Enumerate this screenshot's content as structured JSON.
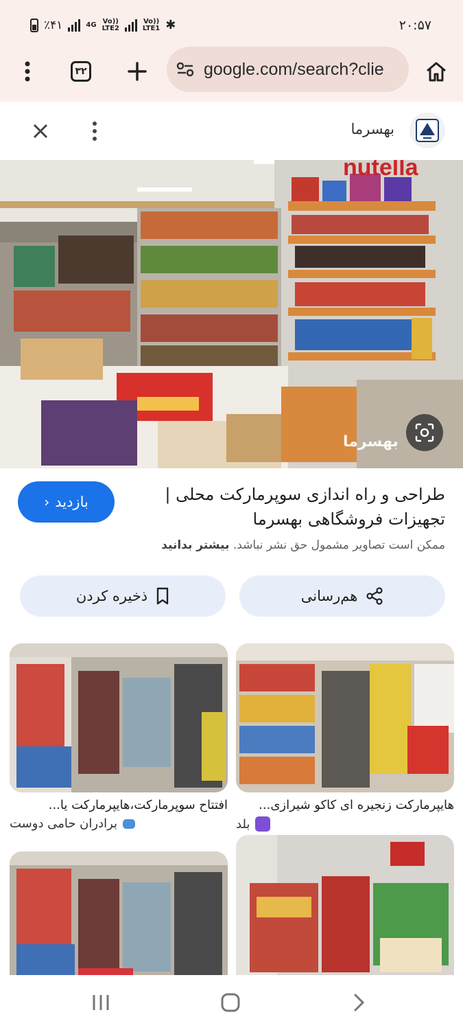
{
  "status_bar": {
    "time": "۲۰:۵۷",
    "battery": "٪۴۱",
    "net1": "4G",
    "net2": "Vo))\nLTE2",
    "net3": "Vo))\nLTE1"
  },
  "browser": {
    "tab_count": "۳۲",
    "url": "google.com/search?clie"
  },
  "panel": {
    "source_name": "بهسرما",
    "watermark": "بهسرما",
    "title": "طراحی و راه اندازی سوپرمارکت محلی | تجهیزات فروشگاهی بهسرما",
    "visit_label": "بازدید",
    "copyright_text": "ممکن است تصاویر مشمول حق نشر نباشد.",
    "learn_more": "بیشتر بدانید",
    "share_label": "هم‌رسانی",
    "save_label": "ذخیره کردن"
  },
  "related": [
    {
      "title": "هایپرمارکت زنجیره ای کاکو شیرازی...",
      "source": "بلد",
      "source_color": "#7b4fd6"
    },
    {
      "title": "افتتاح سوپرمارکت،هایپرمارکت یا...",
      "source": "برادران حامی دوست",
      "source_color": "#4a90d9"
    },
    {
      "title": "",
      "source": "",
      "source_color": "#cccccc"
    },
    {
      "title": "",
      "source": "",
      "source_color": "#cccccc"
    }
  ],
  "icons": {
    "menu": "more-vert-icon",
    "new_tab": "plus-icon",
    "site_settings": "tune-icon",
    "home": "home-icon",
    "close": "close-icon",
    "share": "share-icon",
    "bookmark": "bookmark-icon",
    "lens": "lens-icon"
  },
  "colors": {
    "chrome_bg": "#fbefec",
    "url_pill": "#efdcd7",
    "visit_button": "#1a73e8",
    "action_button": "#e8eef9"
  }
}
